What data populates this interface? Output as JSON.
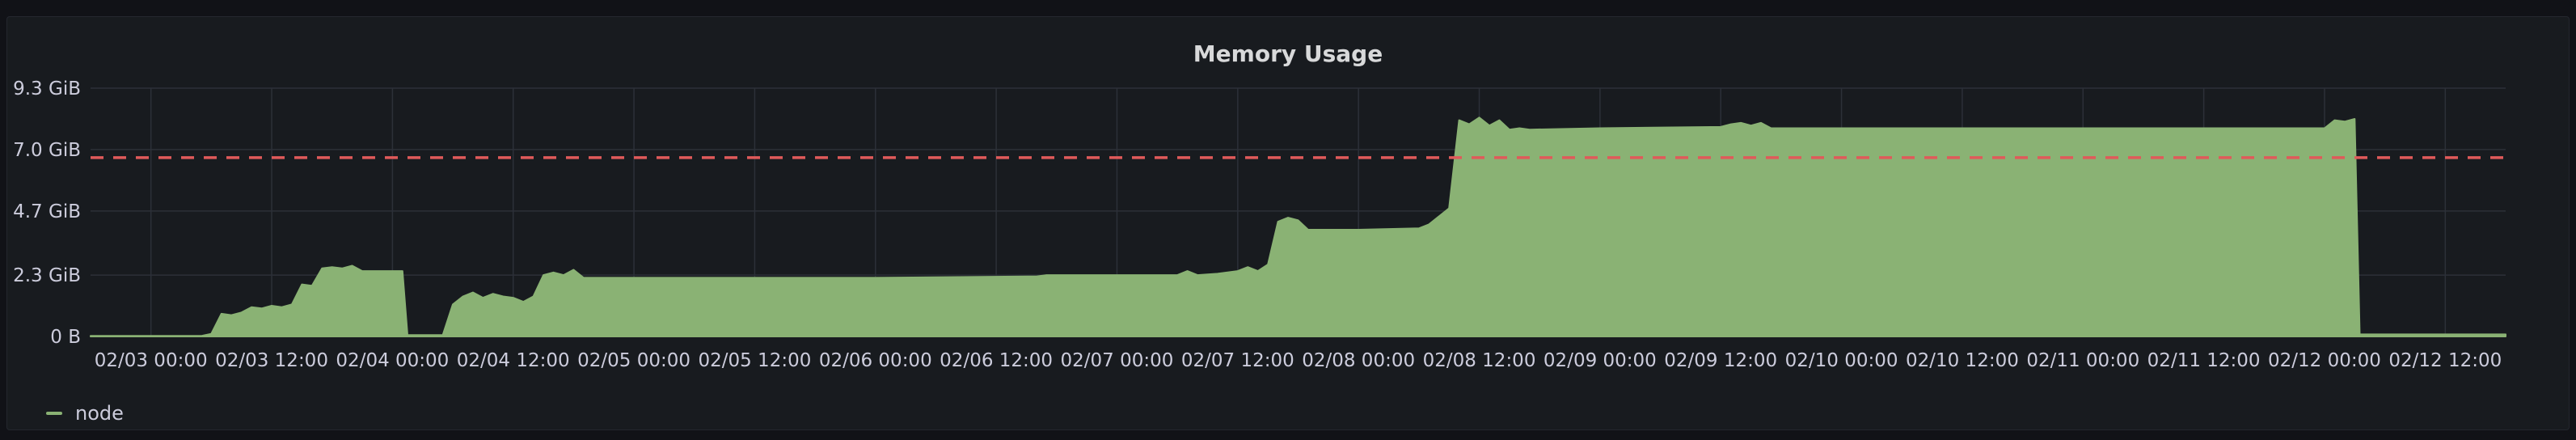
{
  "panel": {
    "title": "Memory Usage"
  },
  "colors": {
    "background": "#111217",
    "panel_background": "#181b1f",
    "grid": "#2c3038",
    "text": "#ccccdc",
    "series_fill": "#8ab274",
    "threshold": "#e05a5a"
  },
  "legend": {
    "items": [
      {
        "label": "node",
        "icon": "line-swatch-icon"
      }
    ]
  },
  "chart_data": {
    "type": "area",
    "title": "Memory Usage",
    "xlabel": "",
    "ylabel": "",
    "y_unit": "GiB",
    "ylim": [
      0,
      9.3
    ],
    "y_ticks": [
      {
        "value": 0,
        "label": "0 B"
      },
      {
        "value": 2.3,
        "label": "2.3 GiB"
      },
      {
        "value": 4.7,
        "label": "4.7 GiB"
      },
      {
        "value": 7.0,
        "label": "7.0 GiB"
      },
      {
        "value": 9.3,
        "label": "9.3 GiB"
      }
    ],
    "xlim": [
      "02/02 18:00",
      "02/12 18:00"
    ],
    "x_ticks": [
      "02/03 00:00",
      "02/03 12:00",
      "02/04 00:00",
      "02/04 12:00",
      "02/05 00:00",
      "02/05 12:00",
      "02/06 00:00",
      "02/06 12:00",
      "02/07 00:00",
      "02/07 12:00",
      "02/08 00:00",
      "02/08 12:00",
      "02/09 00:00",
      "02/09 12:00",
      "02/10 00:00",
      "02/10 12:00",
      "02/11 00:00",
      "02/11 12:00",
      "02/12 00:00",
      "02/12 12:00"
    ],
    "grid": true,
    "legend_position": "bottom-left",
    "threshold": {
      "value": 6.7,
      "style": "dashed",
      "color": "#e05a5a"
    },
    "series": [
      {
        "name": "node",
        "color": "#8ab274",
        "points": [
          [
            "02/02 18:00",
            0.02
          ],
          [
            "02/03 05:00",
            0.02
          ],
          [
            "02/03 06:00",
            0.1
          ],
          [
            "02/03 07:00",
            0.85
          ],
          [
            "02/03 08:00",
            0.8
          ],
          [
            "02/03 09:00",
            0.9
          ],
          [
            "02/03 10:00",
            1.1
          ],
          [
            "02/03 11:00",
            1.05
          ],
          [
            "02/03 12:00",
            1.15
          ],
          [
            "02/03 13:00",
            1.1
          ],
          [
            "02/03 14:00",
            1.2
          ],
          [
            "02/03 15:00",
            1.95
          ],
          [
            "02/03 16:00",
            1.9
          ],
          [
            "02/03 17:00",
            2.55
          ],
          [
            "02/03 18:00",
            2.6
          ],
          [
            "02/03 19:00",
            2.55
          ],
          [
            "02/03 20:00",
            2.65
          ],
          [
            "02/03 21:00",
            2.45
          ],
          [
            "02/04 00:00",
            2.45
          ],
          [
            "02/04 01:00",
            2.45
          ],
          [
            "02/04 01:30",
            0.05
          ],
          [
            "02/04 05:00",
            0.05
          ],
          [
            "02/04 06:00",
            1.2
          ],
          [
            "02/04 07:00",
            1.5
          ],
          [
            "02/04 08:00",
            1.65
          ],
          [
            "02/04 09:00",
            1.45
          ],
          [
            "02/04 10:00",
            1.6
          ],
          [
            "02/04 11:00",
            1.5
          ],
          [
            "02/04 12:00",
            1.45
          ],
          [
            "02/04 13:00",
            1.3
          ],
          [
            "02/04 14:00",
            1.5
          ],
          [
            "02/04 15:00",
            2.3
          ],
          [
            "02/04 16:00",
            2.4
          ],
          [
            "02/04 17:00",
            2.3
          ],
          [
            "02/04 18:00",
            2.5
          ],
          [
            "02/04 19:00",
            2.2
          ],
          [
            "02/05 00:00",
            2.2
          ],
          [
            "02/06 00:00",
            2.2
          ],
          [
            "02/06 16:00",
            2.25
          ],
          [
            "02/06 17:00",
            2.3
          ],
          [
            "02/07 00:00",
            2.3
          ],
          [
            "02/07 06:00",
            2.3
          ],
          [
            "02/07 07:00",
            2.45
          ],
          [
            "02/07 08:00",
            2.3
          ],
          [
            "02/07 10:00",
            2.35
          ],
          [
            "02/07 12:00",
            2.45
          ],
          [
            "02/07 13:00",
            2.6
          ],
          [
            "02/07 14:00",
            2.45
          ],
          [
            "02/07 15:00",
            2.7
          ],
          [
            "02/07 16:00",
            4.3
          ],
          [
            "02/07 17:00",
            4.45
          ],
          [
            "02/07 18:00",
            4.35
          ],
          [
            "02/07 19:00",
            4.0
          ],
          [
            "02/08 00:00",
            4.0
          ],
          [
            "02/08 06:00",
            4.05
          ],
          [
            "02/08 07:00",
            4.2
          ],
          [
            "02/08 08:00",
            4.5
          ],
          [
            "02/08 09:00",
            4.8
          ],
          [
            "02/08 10:00",
            8.1
          ],
          [
            "02/08 11:00",
            7.95
          ],
          [
            "02/08 12:00",
            8.2
          ],
          [
            "02/08 13:00",
            7.9
          ],
          [
            "02/08 14:00",
            8.1
          ],
          [
            "02/08 15:00",
            7.75
          ],
          [
            "02/08 16:00",
            7.8
          ],
          [
            "02/08 17:00",
            7.75
          ],
          [
            "02/09 00:00",
            7.8
          ],
          [
            "02/09 12:00",
            7.85
          ],
          [
            "02/09 13:00",
            7.95
          ],
          [
            "02/09 14:00",
            8.0
          ],
          [
            "02/09 15:00",
            7.9
          ],
          [
            "02/09 16:00",
            8.0
          ],
          [
            "02/09 17:00",
            7.8
          ],
          [
            "02/10 00:00",
            7.8
          ],
          [
            "02/11 00:00",
            7.8
          ],
          [
            "02/12 00:00",
            7.8
          ],
          [
            "02/12 01:00",
            8.1
          ],
          [
            "02/12 02:00",
            8.05
          ],
          [
            "02/12 03:00",
            8.15
          ],
          [
            "02/12 03:30",
            0.08
          ],
          [
            "02/12 18:00",
            0.08
          ]
        ]
      }
    ]
  }
}
